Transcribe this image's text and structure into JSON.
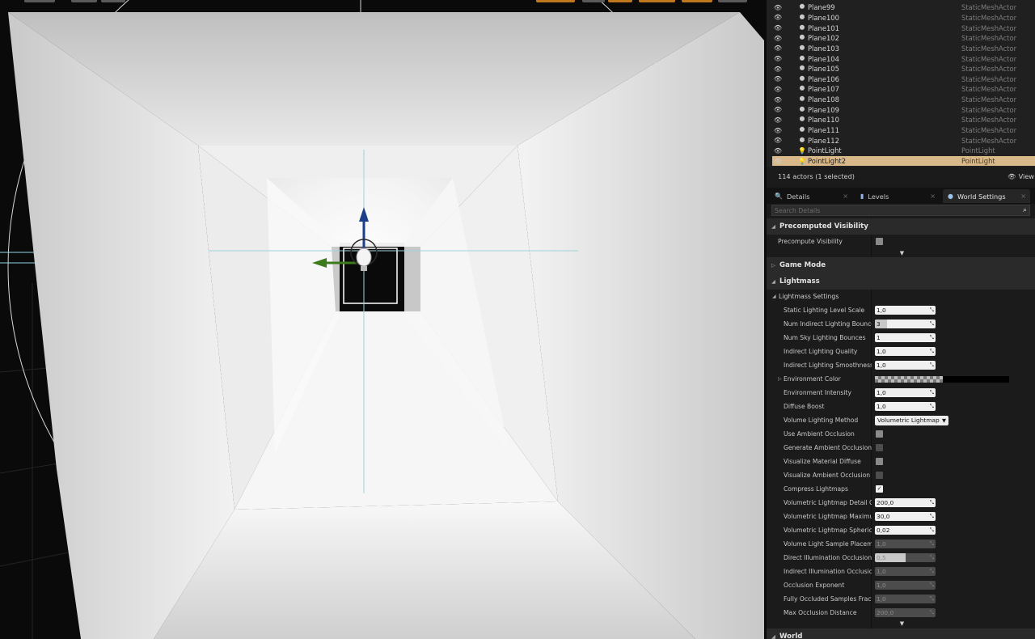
{
  "outliner": {
    "rows": [
      {
        "name": "Plane99",
        "type": "StaticMeshActor",
        "icon": "static-mesh-icon"
      },
      {
        "name": "Plane100",
        "type": "StaticMeshActor",
        "icon": "static-mesh-icon"
      },
      {
        "name": "Plane101",
        "type": "StaticMeshActor",
        "icon": "static-mesh-icon"
      },
      {
        "name": "Plane102",
        "type": "StaticMeshActor",
        "icon": "static-mesh-icon"
      },
      {
        "name": "Plane103",
        "type": "StaticMeshActor",
        "icon": "static-mesh-icon"
      },
      {
        "name": "Plane104",
        "type": "StaticMeshActor",
        "icon": "static-mesh-icon"
      },
      {
        "name": "Plane105",
        "type": "StaticMeshActor",
        "icon": "static-mesh-icon"
      },
      {
        "name": "Plane106",
        "type": "StaticMeshActor",
        "icon": "static-mesh-icon"
      },
      {
        "name": "Plane107",
        "type": "StaticMeshActor",
        "icon": "static-mesh-icon"
      },
      {
        "name": "Plane108",
        "type": "StaticMeshActor",
        "icon": "static-mesh-icon"
      },
      {
        "name": "Plane109",
        "type": "StaticMeshActor",
        "icon": "static-mesh-icon"
      },
      {
        "name": "Plane110",
        "type": "StaticMeshActor",
        "icon": "static-mesh-icon"
      },
      {
        "name": "Plane111",
        "type": "StaticMeshActor",
        "icon": "static-mesh-icon"
      },
      {
        "name": "Plane112",
        "type": "StaticMeshActor",
        "icon": "static-mesh-icon"
      },
      {
        "name": "PointLight",
        "type": "PointLight",
        "icon": "point-light-icon"
      },
      {
        "name": "PointLight2",
        "type": "PointLight",
        "icon": "point-light-icon",
        "selected": true
      }
    ],
    "status": "114 actors (1 selected)",
    "view_label": "View"
  },
  "tabs": [
    {
      "label": "Details",
      "icon": "search-icon"
    },
    {
      "label": "Levels",
      "icon": "levels-icon"
    },
    {
      "label": "World Settings",
      "icon": "globe-icon",
      "active": true
    }
  ],
  "search": {
    "placeholder": "Search Details"
  },
  "details": {
    "precomputed_visibility": {
      "title": "Precomputed Visibility",
      "precompute_label": "Precompute Visibility"
    },
    "game_mode": {
      "title": "Game Mode"
    },
    "lightmass": {
      "title": "Lightmass",
      "settings_title": "Lightmass Settings",
      "props": [
        {
          "label": "Static Lighting Level Scale",
          "kind": "num",
          "value": "1,0"
        },
        {
          "label": "Num Indirect Lighting Bounces",
          "kind": "num",
          "value": "3",
          "slider_fraction": 0.2
        },
        {
          "label": "Num Sky Lighting Bounces",
          "kind": "num",
          "value": "1"
        },
        {
          "label": "Indirect Lighting Quality",
          "kind": "num",
          "value": "1,0"
        },
        {
          "label": "Indirect Lighting Smoothness",
          "kind": "num",
          "value": "1,0"
        },
        {
          "label": "Environment Color",
          "kind": "color",
          "value": "#000000",
          "expandable": true
        },
        {
          "label": "Environment Intensity",
          "kind": "num",
          "value": "1,0"
        },
        {
          "label": "Diffuse Boost",
          "kind": "num",
          "value": "1,0"
        },
        {
          "label": "Volume Lighting Method",
          "kind": "combo",
          "value": "Volumetric Lightmap"
        },
        {
          "label": "Use Ambient Occlusion",
          "kind": "check",
          "checked": false
        },
        {
          "label": "Generate Ambient Occlusion M",
          "kind": "check",
          "checked": false,
          "disabled": true
        },
        {
          "label": "Visualize Material Diffuse",
          "kind": "check",
          "checked": false
        },
        {
          "label": "Visualize Ambient Occlusion",
          "kind": "check",
          "checked": false,
          "disabled": true
        },
        {
          "label": "Compress Lightmaps",
          "kind": "check",
          "checked": true
        },
        {
          "label": "Volumetric Lightmap Detail Ce",
          "kind": "num",
          "value": "200,0"
        },
        {
          "label": "Volumetric Lightmap Maximur",
          "kind": "num",
          "value": "30,0"
        },
        {
          "label": "Volumetric Lightmap Spherica",
          "kind": "num",
          "value": "0,02"
        },
        {
          "label": "Volume Light Sample Placeme",
          "kind": "num",
          "value": "1,0",
          "disabled": true
        },
        {
          "label": "Direct Illumination Occlusion F",
          "kind": "num",
          "value": "0,5",
          "disabled": true,
          "slider_fraction": 0.5
        },
        {
          "label": "Indirect Illumination Occlusion",
          "kind": "num",
          "value": "1,0",
          "disabled": true
        },
        {
          "label": "Occlusion Exponent",
          "kind": "num",
          "value": "1,0",
          "disabled": true
        },
        {
          "label": "Fully Occluded Samples Fracti",
          "kind": "num",
          "value": "1,0",
          "disabled": true
        },
        {
          "label": "Max Occlusion Distance",
          "kind": "num",
          "value": "200,0",
          "disabled": true
        }
      ]
    },
    "world": {
      "title": "World"
    }
  }
}
